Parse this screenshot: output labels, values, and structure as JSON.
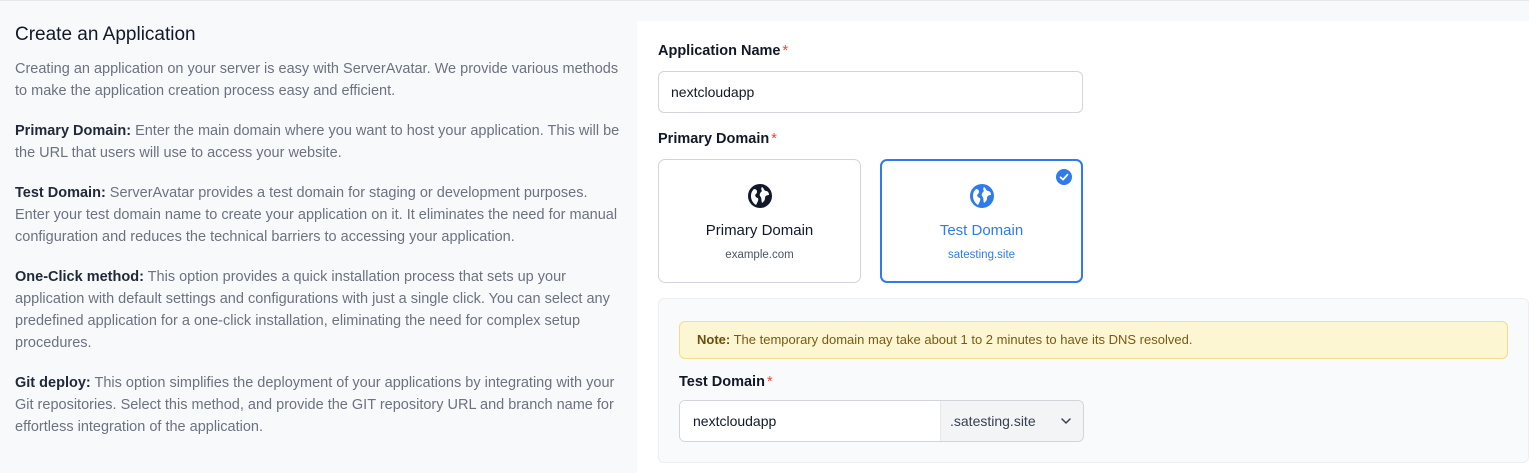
{
  "info": {
    "title": "Create an Application",
    "intro": "Creating an application on your server is easy with ServerAvatar. We provide various methods to make the application creation process easy and efficient.",
    "sections": [
      {
        "term": "Primary Domain:",
        "desc": " Enter the main domain where you want to host your application. This will be the URL that users will use to access your website."
      },
      {
        "term": "Test Domain:",
        "desc": " ServerAvatar provides a test domain for staging or development purposes. Enter your test domain name to create your application on it. It eliminates the need for manual configuration and reduces the technical barriers to accessing your application."
      },
      {
        "term": "One-Click method:",
        "desc": " This option provides a quick installation process that sets up your application with default settings and configurations with just a single click. You can select any predefined application for a one-click installation, eliminating the need for complex setup procedures."
      },
      {
        "term": "Git deploy:",
        "desc": " This option simplifies the deployment of your applications by integrating with your Git repositories. Select this method, and provide the GIT repository URL and branch name for effortless integration of the application."
      }
    ]
  },
  "form": {
    "app_name_label": "Application Name",
    "app_name_value": "nextcloudapp",
    "required_mark": "*",
    "primary_domain_label": "Primary Domain",
    "domain_options": [
      {
        "title": "Primary Domain",
        "subtitle": "example.com",
        "selected": false,
        "icon": "globe-icon"
      },
      {
        "title": "Test Domain",
        "subtitle": "satesting.site",
        "selected": true,
        "icon": "globe-icon"
      }
    ],
    "note_label": "Note:",
    "note_text": " The temporary domain may take about 1 to 2 minutes to have its DNS resolved.",
    "test_domain_label": "Test Domain",
    "test_domain_value": "nextcloudapp",
    "test_domain_suffix": ".satesting.site",
    "suffix_icon": "chevron-down-icon"
  },
  "colors": {
    "accent": "#2f7be9",
    "required": "#ef4444",
    "note_bg": "#fdf6d3",
    "note_text": "#7a5a12"
  }
}
